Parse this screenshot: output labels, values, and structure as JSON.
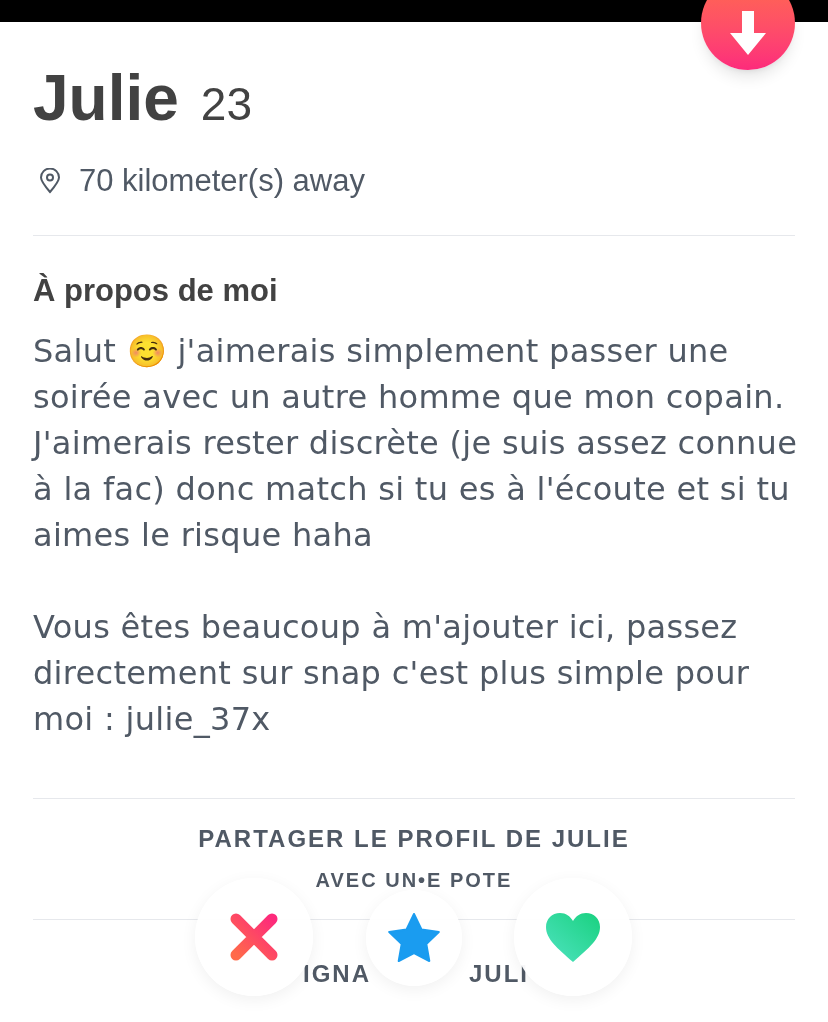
{
  "profile": {
    "name": "Julie",
    "age": "23",
    "distance": "70 kilometer(s) away"
  },
  "about": {
    "heading": "À propos de moi",
    "paragraphs": [
      "Salut ☺️ j'aimerais simplement passer une soirée avec un autre homme que mon copain. J'aimerais rester discrète (je suis assez connue à la fac) donc match si tu es à l'écoute et si tu aimes le risque haha",
      "Vous êtes beaucoup à m'ajouter ici, passez directement sur snap c'est plus simple pour moi : julie_37x"
    ]
  },
  "share": {
    "title": "PARTAGER LE PROFIL DE JULIE",
    "subtitle": "AVEC UN•E POTE"
  },
  "report_fragments": [
    "IGNA",
    "JULI"
  ],
  "actions": [
    {
      "kind": "nope"
    },
    {
      "kind": "super_like"
    },
    {
      "kind": "like"
    }
  ]
}
